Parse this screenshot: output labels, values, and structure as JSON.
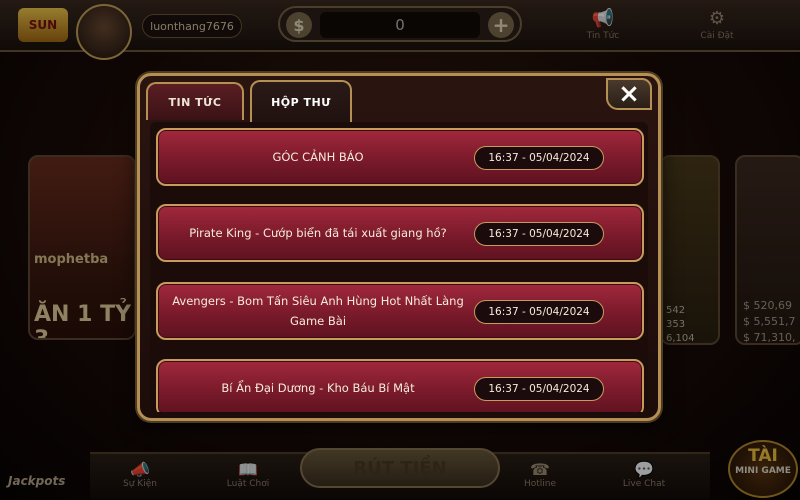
{
  "header": {
    "logo": "SUN",
    "username": "luonthang7676",
    "balance": "0",
    "currency_icon": "$",
    "news_label": "Tin Tức",
    "settings_label": "Cài Đặt"
  },
  "background": {
    "left_card_name": "mophetba",
    "left_card_promo": "ĂN 1 TỶ 3",
    "right_card_values": [
      "$ 520,69",
      "$ 5,551,7",
      "$ 71,310,"
    ],
    "right_card_middle_values": [
      "542",
      "353",
      "6,104"
    ]
  },
  "bottom_nav": {
    "items": [
      {
        "label": "Sự Kiện",
        "icon": "megaphone-icon"
      },
      {
        "label": "Luật Chơi",
        "icon": "book-icon"
      },
      {
        "label": "Hotline",
        "icon": "phone-icon"
      },
      {
        "label": "Live Chat",
        "icon": "chat-icon"
      }
    ],
    "withdraw_label": "RÚT TIỀN",
    "jackpots_label": "Jackpots",
    "mini_game_top": "TÀI",
    "mini_game_bottom": "MINI GAME"
  },
  "modal": {
    "tabs": [
      {
        "label": "TIN TỨC"
      },
      {
        "label": "HỘP THƯ"
      }
    ],
    "active_tab": "HỘP THƯ",
    "close_icon": "×",
    "messages": [
      {
        "title": "GÓC CẢNH BÁO",
        "time": "16:37 - 05/04/2024"
      },
      {
        "title": "Pirate King - Cướp biển đã tái xuất giang hồ?",
        "time": "16:37 - 05/04/2024"
      },
      {
        "title": "Avengers - Bom Tấn Siêu Anh Hùng Hot Nhất Làng Game Bài",
        "time": "16:37 - 05/04/2024"
      },
      {
        "title": "Bí Ẩn Đại Dương - Kho Báu Bí Mật",
        "time": "16:37 - 05/04/2024"
      }
    ]
  },
  "colors": {
    "row_fill": "#7a1a2b",
    "gold_border": "#b58f53",
    "date_pill": "#1c0b0c"
  }
}
